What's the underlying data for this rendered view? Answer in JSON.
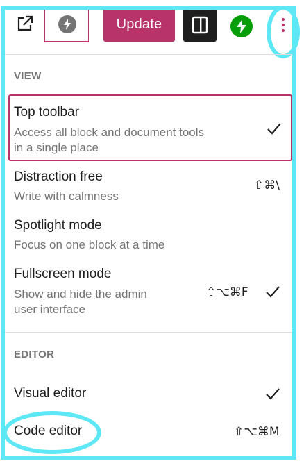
{
  "toolbar": {
    "update_label": "Update",
    "icons": [
      "external-link-icon",
      "jetpack-icon",
      "settings-panel-icon",
      "jetpack-green-icon",
      "more-options-icon"
    ]
  },
  "view": {
    "title": "VIEW",
    "items": [
      {
        "label": "Top toolbar",
        "description_line1": "Access all block and document tools",
        "description_line2": "in a single place",
        "shortcut": "",
        "checked": true
      },
      {
        "label": "Distraction free",
        "description_line1": "Write with calmness",
        "shortcut": "⇧⌘\\",
        "checked": false
      },
      {
        "label": "Spotlight mode",
        "description_line1": "Focus on one block at a time",
        "shortcut": "",
        "checked": false
      },
      {
        "label": "Fullscreen mode",
        "description_line1": "Show and hide the admin",
        "description_line2": "user interface",
        "shortcut": "⇧⌥⌘F",
        "checked": true
      }
    ]
  },
  "editor": {
    "title": "EDITOR",
    "items": [
      {
        "label": "Visual editor",
        "shortcut": "",
        "checked": true
      },
      {
        "label": "Code editor",
        "shortcut": "⇧⌥⌘M",
        "checked": false
      }
    ]
  },
  "colors": {
    "accent": "#b8336a",
    "highlight": "#5ee7f5",
    "jetpack_green": "#069e08",
    "muted_text": "#757575"
  }
}
